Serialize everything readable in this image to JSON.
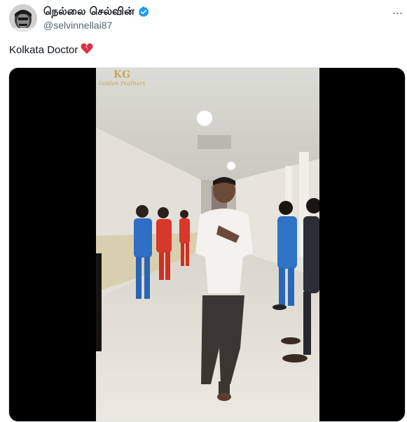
{
  "tweet": {
    "display_name": "நெல்லை செல்வின்",
    "handle": "@selvinnellai87",
    "text": "Kolkata Doctor",
    "emoji": "💔",
    "more_label": "···"
  },
  "video": {
    "watermark_logo": "KG",
    "watermark_text": "Golden Feathers"
  },
  "icons": {
    "verified": "verified-badge-icon",
    "more": "more-options-icon"
  },
  "colors": {
    "verified_blue": "#1d9bf0",
    "text_primary": "#0f1419",
    "text_secondary": "#536471"
  }
}
